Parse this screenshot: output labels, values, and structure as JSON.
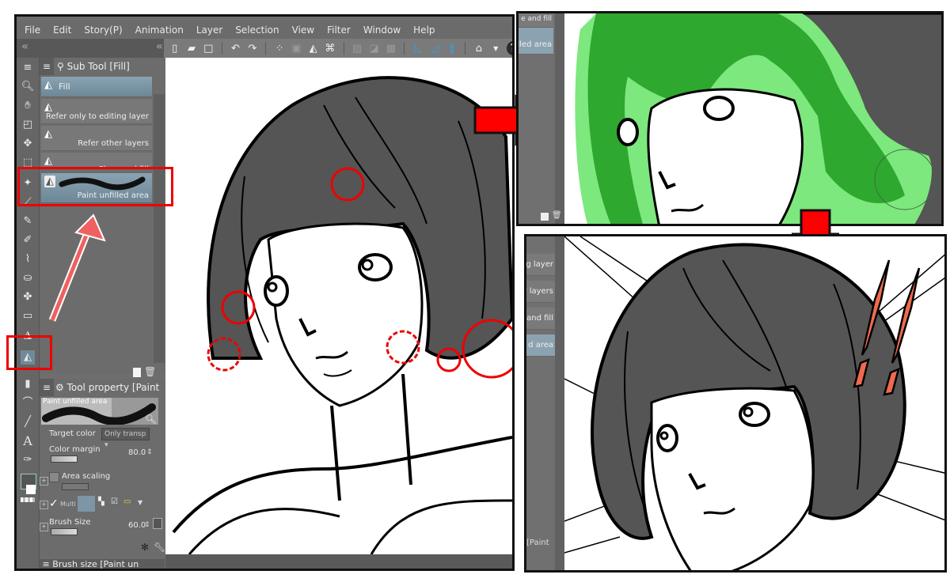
{
  "menubar": {
    "items": [
      "File",
      "Edit",
      "Story(P)",
      "Animation",
      "Layer",
      "Selection",
      "View",
      "Filter",
      "Window",
      "Help"
    ]
  },
  "toolbar": {
    "icons": [
      "new-file-icon",
      "open-folder-icon",
      "save-icon",
      "undo-icon",
      "redo-icon",
      "selection-dots-icon",
      "transform-icon",
      "fill-bucket-icon",
      "crop-icon",
      "clear-selection-icon",
      "invert-selection-icon",
      "select-all-icon",
      "ruler-snap-icon",
      "ruler-snap-2-icon",
      "ruler-snap-3-icon",
      "monitor-icon",
      "help-icon"
    ],
    "collapse_glyph": "«",
    "help_glyph": "?"
  },
  "subtool_panel": {
    "title": "Sub Tool [Fill]",
    "items": [
      {
        "label": "Fill",
        "selected": false,
        "highlighted": true
      },
      {
        "label": "Refer only to editing layer",
        "selected": false
      },
      {
        "label": "Refer other layers",
        "selected": false
      },
      {
        "label": "Close and fill",
        "selected": false
      },
      {
        "label": "Paint unfilled area",
        "selected": true
      }
    ]
  },
  "tool_property": {
    "title": "Tool property [Paint",
    "preview_label": "Paint unfilled area",
    "target_color": {
      "label": "Target color",
      "value": "Only transp"
    },
    "color_margin": {
      "label": "Color margin",
      "value": "80.0"
    },
    "area_scaling": {
      "label": "Area scaling",
      "checked": false
    },
    "multi": {
      "label": "Multi",
      "checked": true
    },
    "brush_size": {
      "label": "Brush Size",
      "value": "60.0"
    }
  },
  "brush_size_panel": {
    "title": "Brush size [Paint un"
  },
  "right_top_panel": {
    "subtool_fragments": [
      "e and fill",
      "lled area"
    ]
  },
  "right_bottom_panel": {
    "subtool_fragments": [
      "g layer",
      "r layers",
      "and fill",
      "d area"
    ],
    "tool_property_fragment": "[Paint"
  },
  "annotations": {
    "highlight_color": "#e00000",
    "arrow_color": "#f06060",
    "fill_green": "#2ea82e",
    "fill_light_green": "#7de87d",
    "hair_gray": "#555555",
    "exclaim_color": "#f06a50"
  }
}
